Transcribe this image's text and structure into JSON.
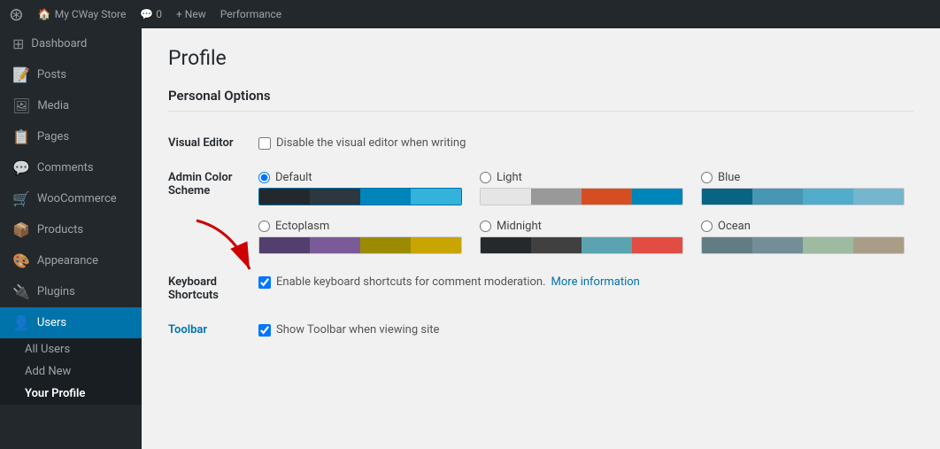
{
  "topbar": {
    "wp_logo": "🆆",
    "site_name": "My CWay Store",
    "comments_label": "Comments",
    "comments_count": "0",
    "new_label": "+ New",
    "performance_label": "Performance"
  },
  "sidebar": {
    "items": [
      {
        "id": "dashboard",
        "label": "Dashboard",
        "icon": "⊞"
      },
      {
        "id": "posts",
        "label": "Posts",
        "icon": "📄"
      },
      {
        "id": "media",
        "label": "Media",
        "icon": "🖼"
      },
      {
        "id": "pages",
        "label": "Pages",
        "icon": "📋"
      },
      {
        "id": "comments",
        "label": "Comments",
        "icon": "💬"
      },
      {
        "id": "woocommerce",
        "label": "WooCommerce",
        "icon": "🛒"
      },
      {
        "id": "products",
        "label": "Products",
        "icon": "📦"
      },
      {
        "id": "appearance",
        "label": "Appearance",
        "icon": "🎨"
      },
      {
        "id": "plugins",
        "label": "Plugins",
        "icon": "🔌"
      },
      {
        "id": "users",
        "label": "Users",
        "icon": "👤",
        "active": true
      }
    ],
    "users_submenu": [
      {
        "id": "all-users",
        "label": "All Users"
      },
      {
        "id": "add-new",
        "label": "Add New"
      },
      {
        "id": "your-profile",
        "label": "Your Profile",
        "active": true
      }
    ]
  },
  "main": {
    "page_title": "Profile",
    "section_title": "Personal Options",
    "visual_editor_label": "Visual Editor",
    "visual_editor_checkbox_label": "Disable the visual editor when writing",
    "admin_color_scheme_label": "Admin Color Scheme",
    "keyboard_shortcuts_label": "Keyboard Shortcuts",
    "keyboard_shortcuts_checkbox_label": "Enable keyboard shortcuts for comment moderation.",
    "keyboard_shortcuts_link": "More information",
    "toolbar_label": "Toolbar",
    "toolbar_checkbox_label": "Show Toolbar when viewing site",
    "color_schemes": [
      {
        "id": "default",
        "label": "Default",
        "selected": true,
        "swatches": [
          "#23282d",
          "#2e3640",
          "#0085ba",
          "#33b3db"
        ]
      },
      {
        "id": "light",
        "label": "Light",
        "selected": false,
        "swatches": [
          "#e5e5e5",
          "#999",
          "#d54e21",
          "#0085ba"
        ]
      },
      {
        "id": "blue",
        "label": "Blue",
        "selected": false,
        "swatches": [
          "#096484",
          "#4796b3",
          "#52accc",
          "#74b6ce"
        ]
      },
      {
        "id": "ectoplasm",
        "label": "Ectoplasm",
        "selected": false,
        "swatches": [
          "#523f6d",
          "#7a5b97",
          "#9b8b00",
          "#c8a500"
        ]
      },
      {
        "id": "midnight",
        "label": "Midnight",
        "selected": false,
        "swatches": [
          "#26292c",
          "#404040",
          "#5ba3b0",
          "#e14d43"
        ]
      },
      {
        "id": "ocean",
        "label": "Ocean",
        "selected": false,
        "swatches": [
          "#627c83",
          "#738e96",
          "#9ebaa0",
          "#aa9d88"
        ]
      }
    ]
  }
}
